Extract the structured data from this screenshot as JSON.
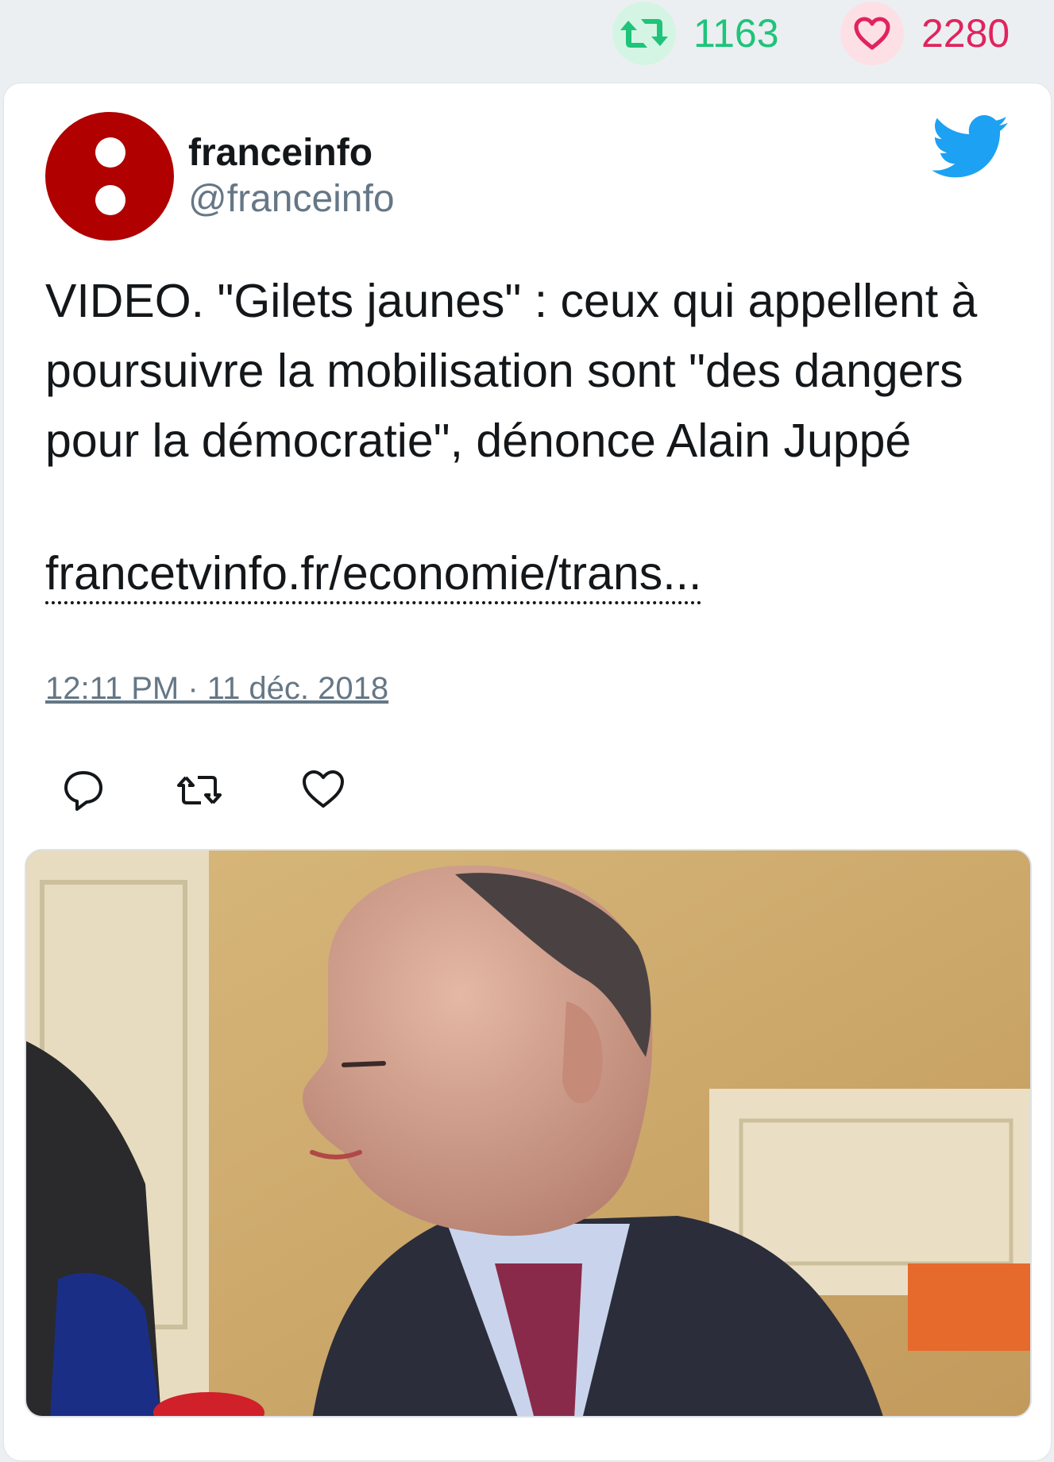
{
  "stats": {
    "retweets": "1163",
    "likes": "2280",
    "retweet_icon": "retweet-icon",
    "like_icon": "heart-icon",
    "retweet_color": "#1ec47a",
    "like_color": "#e0245e"
  },
  "tweet": {
    "author_name": "franceinfo",
    "author_handle": "@franceinfo",
    "text": "VIDEO. \"Gilets jaunes\" : ceux qui appellent à poursuivre la mobilisation sont \"des dangers pour la démocratie\", dénonce Alain Juppé",
    "link": "francetvinfo.fr/economie/trans...",
    "timestamp": "12:11 PM · 11 déc. 2018",
    "brand_icon": "twitter-bird-icon",
    "brand_color": "#1da1f2",
    "actions": [
      "reply-icon",
      "retweet-icon",
      "heart-icon"
    ]
  },
  "media": {
    "type": "photo"
  }
}
